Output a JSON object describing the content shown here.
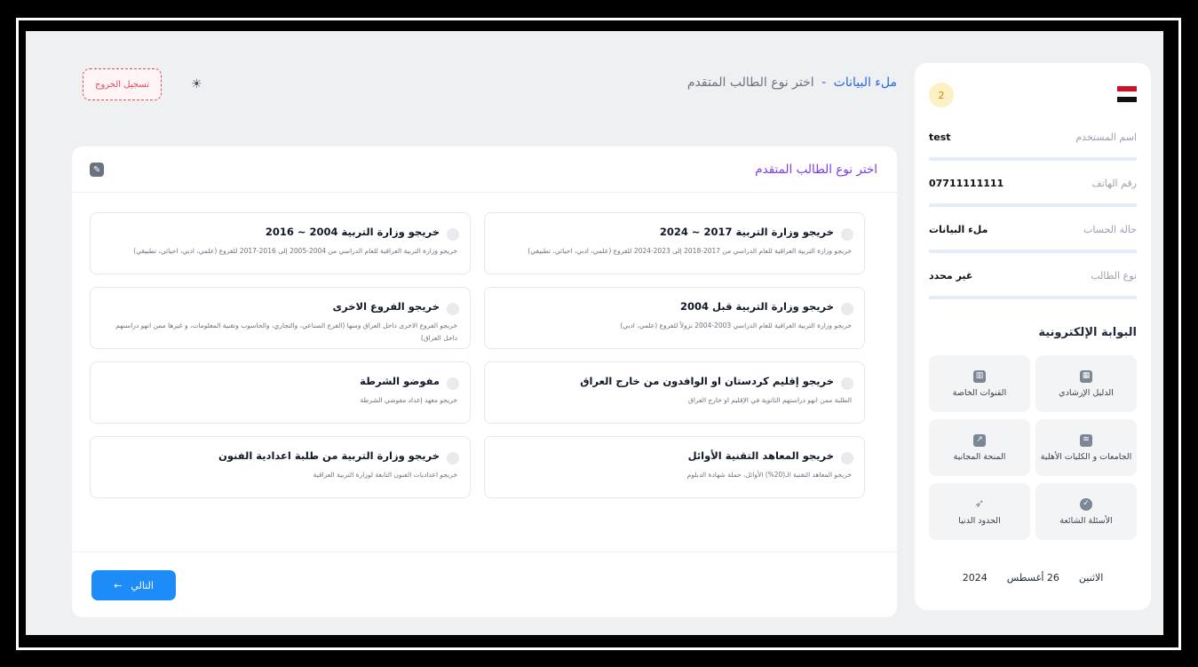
{
  "header": {
    "breadcrumb_main": "ملء البيانات",
    "breadcrumb_sep": "-",
    "breadcrumb_sub": "اختر نوع الطالب المتقدم",
    "logout_label": "تسجيل الخروج",
    "theme_icon": "sun-icon"
  },
  "sidebar": {
    "notification_count": "2",
    "user_info": [
      {
        "label": "اسم المستخدم",
        "value": "test"
      },
      {
        "label": "رقم الهاتف",
        "value": "07711111111"
      },
      {
        "label": "حالة الحساب",
        "value": "ملء البيانات"
      },
      {
        "label": "نوع الطالب",
        "value": "غير محدد"
      }
    ],
    "portal_title": "البوابة الإلكترونية",
    "tiles": [
      {
        "label": "الدليل الإرشادي",
        "icon": "calendar-icon"
      },
      {
        "label": "القنوات الخاصة",
        "icon": "channels-icon"
      },
      {
        "label": "الجامعات و الكليات الأهلية",
        "icon": "wifi-icon"
      },
      {
        "label": "المنحة المجانية",
        "icon": "chart-icon"
      },
      {
        "label": "الأسئلة الشائعة",
        "icon": "shield-icon"
      },
      {
        "label": "الحدود الدنيا",
        "icon": "rocket-icon"
      }
    ],
    "date": {
      "day": "الاثنين",
      "date": "26 أغسطس",
      "year": "2024"
    }
  },
  "main": {
    "title": "اختر نوع الطالب المتقدم",
    "options": [
      {
        "title": "خريجو وزارة التربية 2017 ~ 2024",
        "desc": "خريجو وزارة التربية العراقية للعام الدراسي من 2017-2018 إلى 2023-2024 للفروع (علمي، ادبي، احيائي، تطبيقي)"
      },
      {
        "title": "خريجو وزارة التربية 2004 ~ 2016",
        "desc": "خريجو وزارة التربية العراقية للعام الدراسي من 2004-2005 إلى 2016-2017 للفروع (علمي، ادبي، احيائي، تطبيقي)"
      },
      {
        "title": "خريجو وزارة التربية قبل 2004",
        "desc": "خريجو وزارة التربية العراقية للعام الدراسي 2003-2004 نزولاً للفروع (علمي، ادبي)"
      },
      {
        "title": "خريجو الفروع الاخرى",
        "desc": "خريجو الفروع الاخرى داخل العراق ومنها (الفرع الصناعي، والتجاري، والحاسوب وتقنية المعلومات، و غيرها ممن انهو دراستهم داخل العراق)"
      },
      {
        "title": "خريجو إقليم كردستان او الوافدون من خارج العراق",
        "desc": "الطلبة ممن انهو دراستهم الثانوية في الإقليم او خارج العراق"
      },
      {
        "title": "مفوضو الشرطة",
        "desc": "خريجو معهد إعداد مفوضي الشرطة"
      },
      {
        "title": "خريجو المعاهد التقنية الأوائل",
        "desc": "خريجو المعاهد التقنية الـ(20%) الأوائل، حملة شهادة الدبلوم"
      },
      {
        "title": "خريجو وزارة التربية من طلبة اعدادية الفنون",
        "desc": "خريجو اعداديات الفنون التابعة لوزارة التربية العراقية"
      }
    ],
    "next_label": "التالي",
    "next_arrow": "←"
  },
  "colors": {
    "accent": "#1d8cf8",
    "title_purple": "#7c3aed",
    "logout_red": "#e24b5b",
    "breadcrumb_blue": "#2563eb"
  }
}
